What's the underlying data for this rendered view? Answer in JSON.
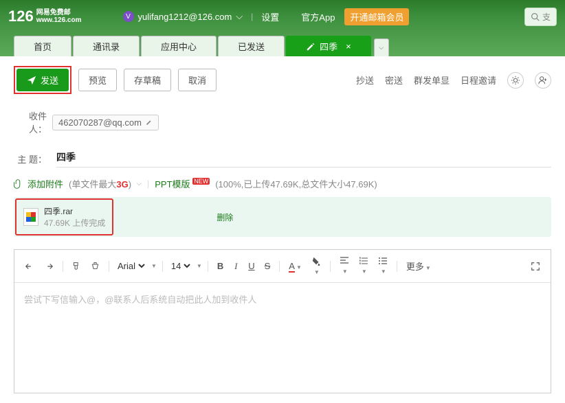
{
  "header": {
    "logo_main": "126",
    "logo_text1": "网易免费邮",
    "logo_text2": "www.126.com",
    "user_email": "yulifang1212@126.com",
    "settings": "设置",
    "app": "官方App",
    "vip": "开通邮箱会员",
    "search_placeholder": "支"
  },
  "tabs": {
    "items": [
      "首页",
      "通讯录",
      "应用中心",
      "已发送"
    ],
    "active_label": "四季"
  },
  "actions": {
    "send": "发送",
    "preview": "预览",
    "save_draft": "存草稿",
    "cancel": "取消"
  },
  "options": {
    "cc": "抄送",
    "bcc": "密送",
    "group": "群发单显",
    "schedule": "日程邀请"
  },
  "fields": {
    "recipient_label": "收件人：",
    "recipient_value": "462070287@qq.com",
    "subject_label": "主 题：",
    "subject_value": "四季"
  },
  "attach": {
    "add_link": "添加附件",
    "max_note_prefix": "(单文件最大",
    "max_note_size": "3G",
    "max_note_suffix": ")",
    "ppt_template": "PPT模版",
    "ppt_badge": "NEW",
    "progress_note": "(100%,已上传47.69K,总文件大小47.69K)"
  },
  "attachment": {
    "filename": "四季.rar",
    "size": "47.69K",
    "status": "上传完成",
    "delete": "删除"
  },
  "toolbar": {
    "font_family": "Arial",
    "font_size": "14",
    "more": "更多"
  },
  "editor": {
    "placeholder": "尝试下写信输入@，@联系人后系统自动把此人加到收件人"
  }
}
